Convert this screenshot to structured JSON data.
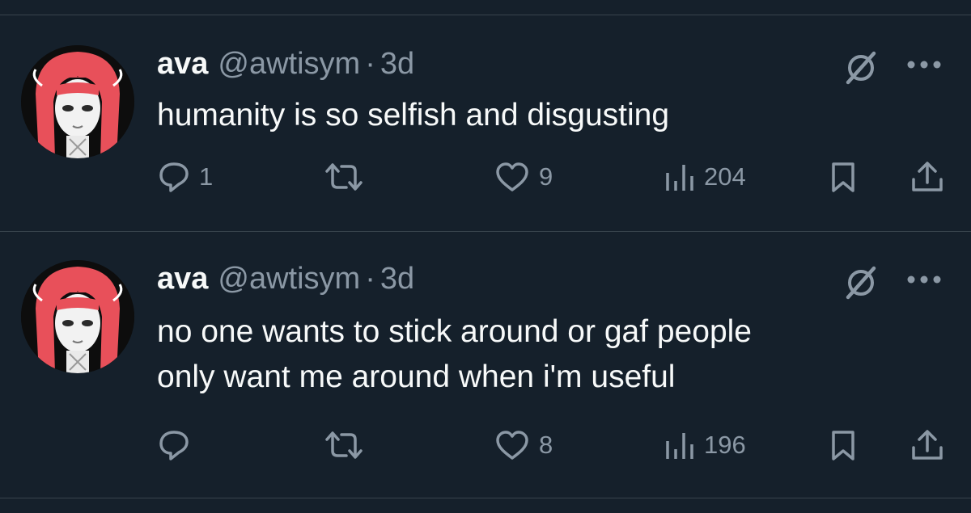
{
  "tweets": [
    {
      "author": "ava",
      "handle": "@awtisym",
      "separator": "·",
      "time": "3d",
      "text": "humanity is so selfish and disgusting",
      "reply_count": "1",
      "retweet_count": "",
      "like_count": "9",
      "view_count": "204"
    },
    {
      "author": "ava",
      "handle": "@awtisym",
      "separator": "·",
      "time": "3d",
      "text_lines": [
        "no one wants to stick around or gaf people",
        "only want me around when i'm useful"
      ],
      "reply_count": "",
      "retweet_count": "",
      "like_count": "8",
      "view_count": "196"
    }
  ],
  "icons": {
    "reply": "reply-icon",
    "retweet": "retweet-icon",
    "like": "heart-icon",
    "views": "views-icon",
    "bookmark": "bookmark-icon",
    "share": "share-icon",
    "grok": "grok-icon",
    "more": "more-icon"
  },
  "colors": {
    "background": "#15202b",
    "divider": "#38444d",
    "text_primary": "#f7f9f9",
    "text_secondary": "#8b98a5",
    "avatar_hair": "#e8505a"
  }
}
